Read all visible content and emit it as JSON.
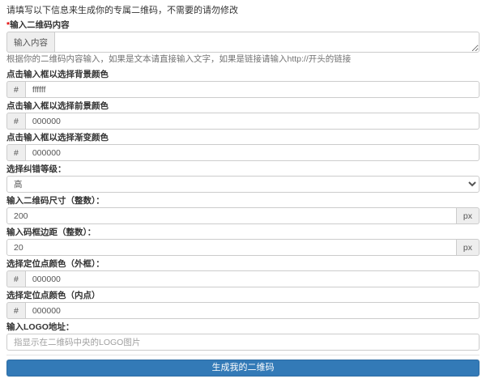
{
  "page": {
    "intro": "请填写以下信息来生成你的专属二维码，不需要的请勿修改"
  },
  "colors": {
    "primary_button": "#337ab7",
    "required_mark": "#e00000",
    "addon_bg": "#eeeeee"
  },
  "form": {
    "content": {
      "required_mark": "*",
      "label": "输入二维码内容",
      "addon": "输入内容",
      "value": "",
      "help": "根据你的二维码内容输入，如果是文本请直接输入文字，如果是链接请输入http://开头的链接"
    },
    "bg_color": {
      "label": "点击输入框以选择背景颜色",
      "addon": "#",
      "value": "ffffff"
    },
    "fg_color": {
      "label": "点击输入框以选择前景颜色",
      "addon": "#",
      "value": "000000"
    },
    "gradient_color": {
      "label": "点击输入框以选择渐变颜色",
      "addon": "#",
      "value": "000000"
    },
    "error_level": {
      "label": "选择纠错等级：",
      "selected": "高"
    },
    "size": {
      "label": "输入二维码尺寸（整数）：",
      "value": "200",
      "unit": "px"
    },
    "margin": {
      "label": "输入码框边距（整数）：",
      "value": "20",
      "unit": "px"
    },
    "eye_outer_color": {
      "label": "选择定位点颜色（外框）：",
      "addon": "#",
      "value": "000000"
    },
    "eye_inner_color": {
      "label": "选择定位点颜色（内点）",
      "addon": "#",
      "value": "000000"
    },
    "logo": {
      "label": "输入LOGO地址：",
      "placeholder": "指显示在二维码中央的LOGO图片"
    },
    "submit_label": "生成我的二维码"
  }
}
